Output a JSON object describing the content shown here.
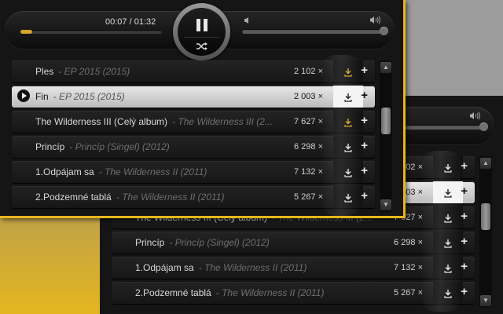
{
  "player": {
    "current_time": "00:07",
    "separator": " / ",
    "total_time": "01:32",
    "progress_fraction": 0.085,
    "volume_fraction": 1.0
  },
  "tracks": [
    {
      "title": "Ples",
      "subtitle": "- EP 2015 (2015)",
      "count": "2 102 ×",
      "active": false
    },
    {
      "title": "Fin",
      "subtitle": "- EP 2015 (2015)",
      "count": "2 003 ×",
      "active": true
    },
    {
      "title": "The Wilderness III (Celý album)",
      "subtitle": "- The Wilderness III (2...",
      "count": "7 627 ×",
      "active": false
    },
    {
      "title": "Princíp",
      "subtitle": "- Princíp (Singel) (2012)",
      "count": "6 298 ×",
      "active": false
    },
    {
      "title": "1.Odpájam sa",
      "subtitle": "- The Wilderness II (2011)",
      "count": "7 132 ×",
      "active": false
    },
    {
      "title": "2.Podzemné tablá",
      "subtitle": "- The Wilderness II (2011)",
      "count": "5 267 ×",
      "active": false
    }
  ],
  "labels": {
    "add": "+"
  },
  "colors": {
    "accent": "#d4a52a",
    "frame": "#e8b61c",
    "active_row": "#d4d4d4"
  },
  "icons": {
    "pause": "pause-icon",
    "shuffle": "shuffle-icon",
    "volume_low": "volume-low-icon",
    "volume_high": "volume-high-icon",
    "download": "download-icon",
    "play": "play-icon"
  }
}
